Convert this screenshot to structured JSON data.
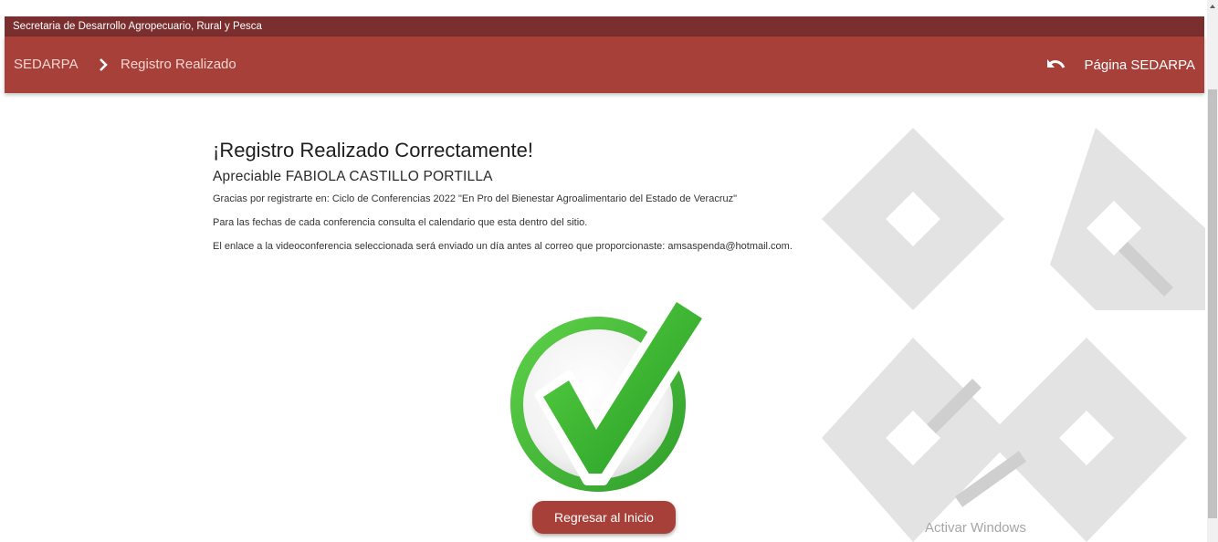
{
  "topbar": {
    "agency": "Secretaria de Desarrollo Agropecuario, Rural y Pesca"
  },
  "nav": {
    "crumb_home": "SEDARPA",
    "crumb_current": "Registro Realizado",
    "right_link": "Página SEDARPA"
  },
  "main": {
    "title": "¡Registro Realizado Correctamente!",
    "greeting": "Apreciable FABIOLA CASTILLO PORTILLA",
    "line1": "Gracias por registrarte en: Ciclo de Conferencias 2022 \"En Pro del Bienestar Agroalimentario del Estado de Veracruz\"",
    "line2": "Para las fechas de cada conferencia consulta el calendario que esta dentro del sitio.",
    "line3": "El enlace a la videoconferencia seleccionada será enviado un día antes al correo que proporcionaste: amsaspenda@hotmail.com.",
    "button": "Regresar al Inicio"
  },
  "watermark": "Activar Windows",
  "icons": {
    "breadcrumb_sep": "chevron-right-icon",
    "back": "undo-icon",
    "success": "checkmark-icon"
  },
  "colors": {
    "topbar": "#7a2e2e",
    "navbar": "#a8403a",
    "check_green": "#3fb83a"
  }
}
